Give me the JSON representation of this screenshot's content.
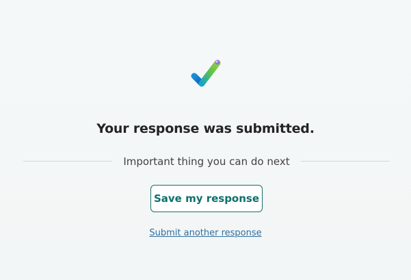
{
  "status": {
    "icon": "checkmark-icon",
    "title": "Your response was submitted."
  },
  "next": {
    "heading": "Important thing you can do next",
    "save_button_label": "Save my response",
    "submit_another_link": "Submit another response"
  },
  "colors": {
    "accent": "#0f6f6c",
    "link": "#2f6f9e",
    "background": "#f4f7f7",
    "title_text": "#242424"
  }
}
